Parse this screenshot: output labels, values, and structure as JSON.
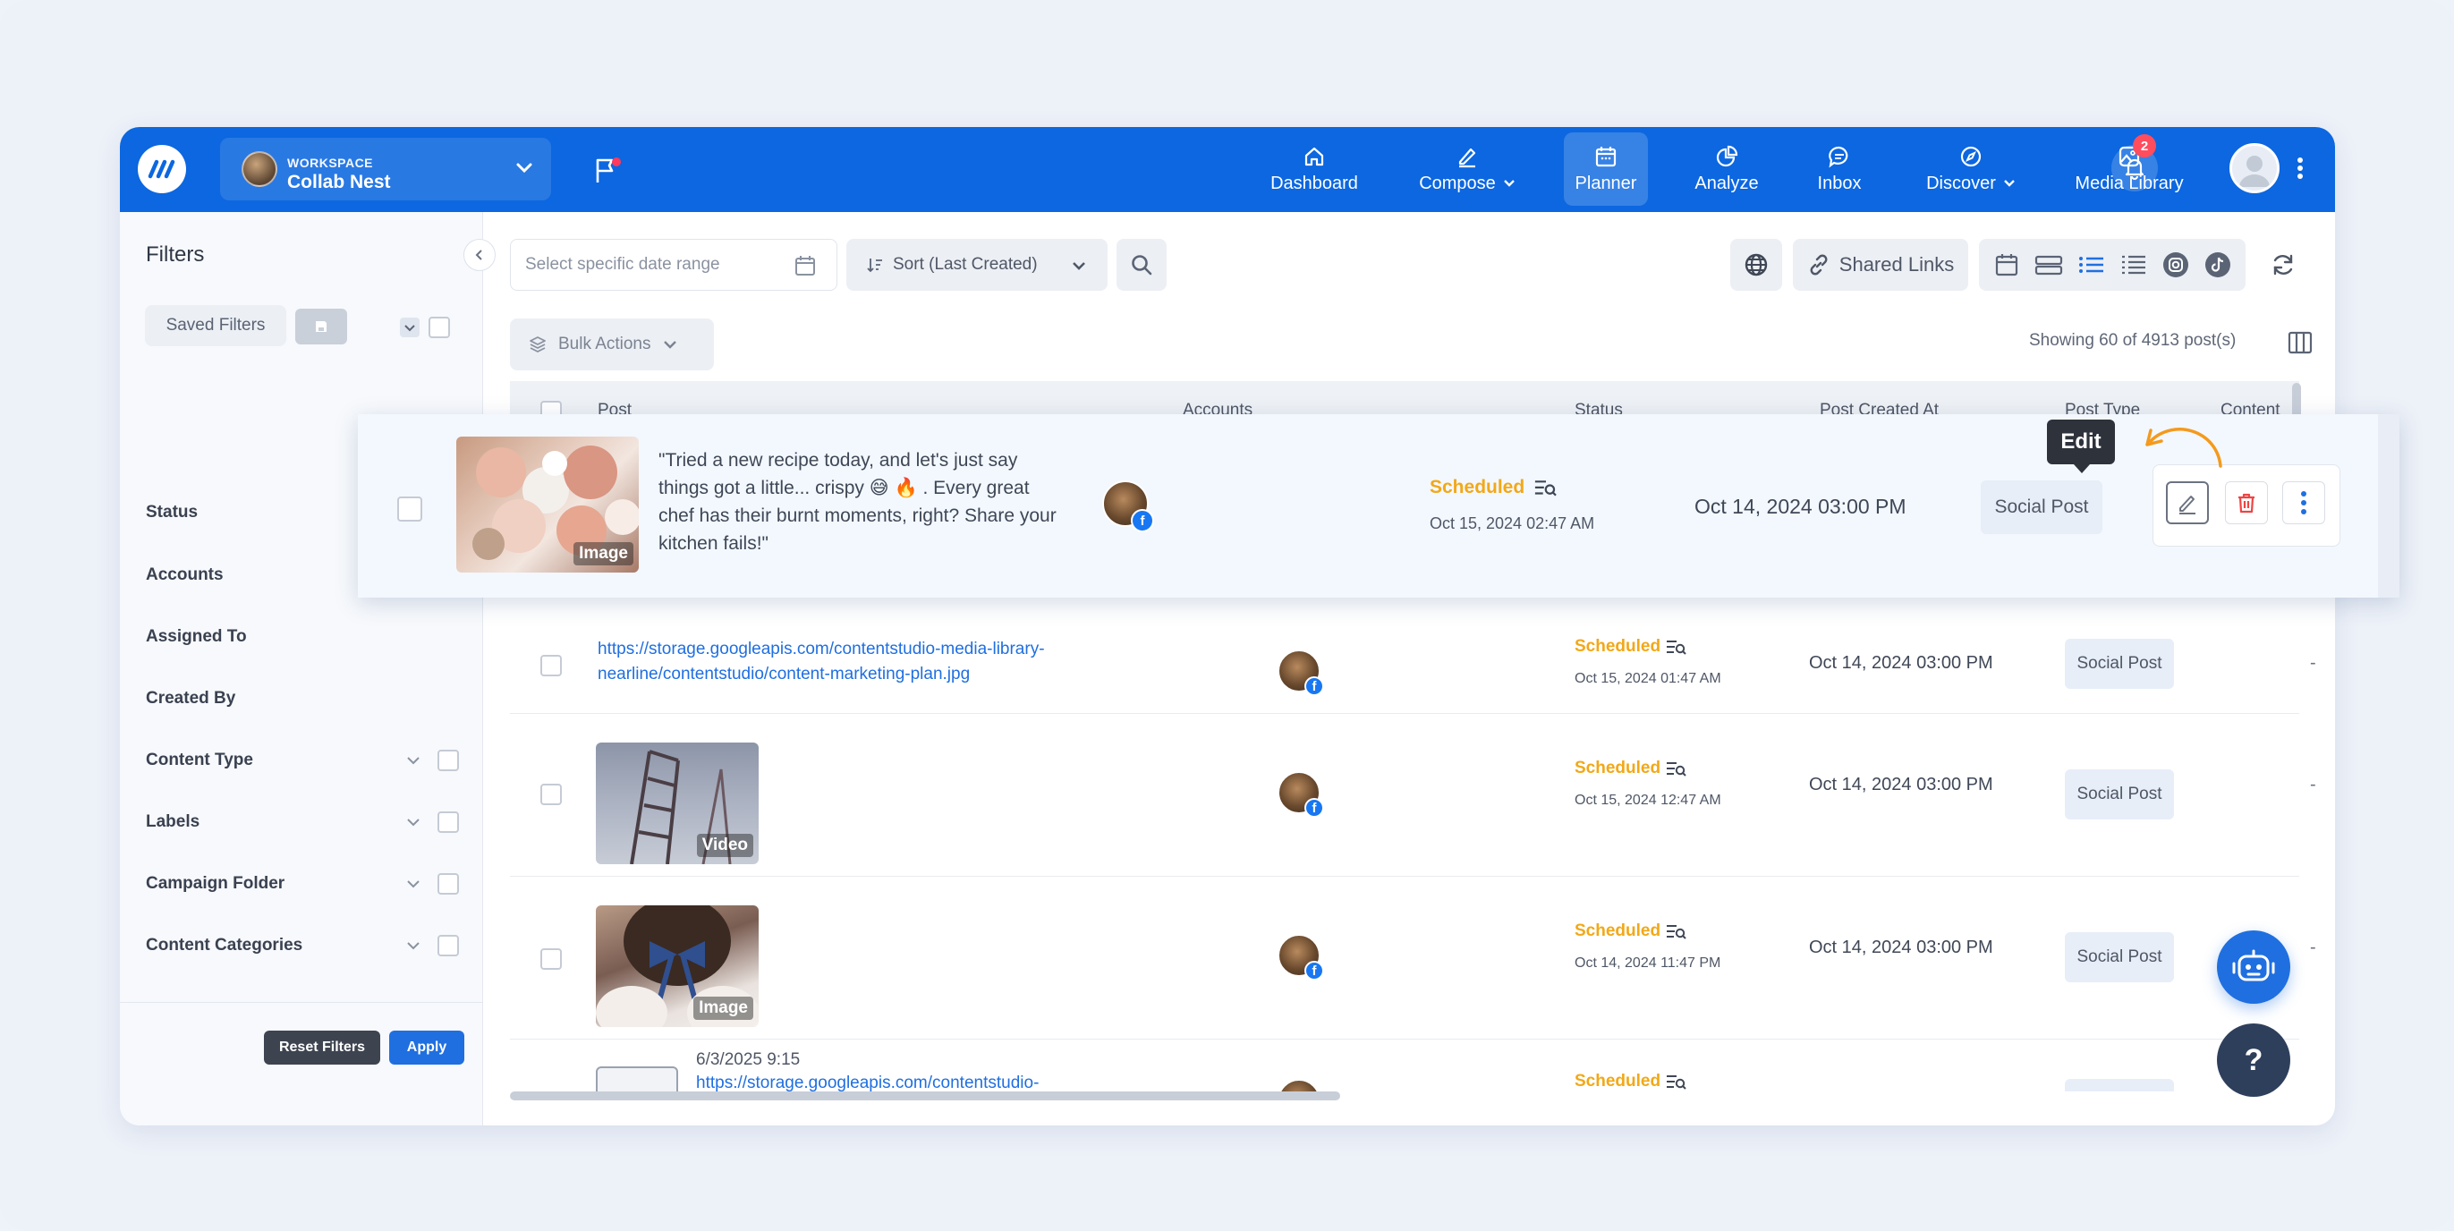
{
  "workspace": {
    "kicker": "WORKSPACE",
    "name": "Collab Nest"
  },
  "nav": {
    "items": [
      {
        "label": "Dashboard",
        "icon": "home-icon"
      },
      {
        "label": "Compose",
        "icon": "pen-icon"
      },
      {
        "label": "Planner",
        "icon": "calendar-icon",
        "active": true
      },
      {
        "label": "Analyze",
        "icon": "pie-chart-icon"
      },
      {
        "label": "Inbox",
        "icon": "chat-icon"
      },
      {
        "label": "Discover",
        "icon": "compass-icon"
      },
      {
        "label": "Media Library",
        "icon": "image-icon"
      }
    ],
    "notification_count": "2"
  },
  "filters": {
    "title": "Filters",
    "saved_filters_label": "Saved Filters",
    "rows": [
      "Status",
      "Accounts",
      "Assigned To",
      "Created By",
      "Content Type",
      "Labels",
      "Campaign Folder",
      "Content Categories"
    ],
    "reset_label": "Reset Filters",
    "apply_label": "Apply"
  },
  "toolbar": {
    "date_placeholder": "Select specific date range",
    "sort_label": "Sort (Last Created)",
    "shared_links_label": "Shared Links",
    "bulk_actions_label": "Bulk Actions",
    "showing_text": "Showing 60 of 4913 post(s)"
  },
  "table": {
    "headers": [
      "Post",
      "Accounts",
      "Status",
      "Post Created At",
      "Post Type",
      "Content Cate"
    ],
    "highlighted": {
      "caption": "\"Tried a new recipe today, and let's just say things got a little... crispy 😅 🔥 . Every great chef has their burnt moments, right? Share your kitchen fails!\"",
      "thumb_tag": "Image",
      "status": "Scheduled",
      "status_date": "Oct 15, 2024 02:47 AM",
      "created_at": "Oct 14, 2024 03:00 PM",
      "post_type": "Social Post",
      "tooltip": "Edit"
    },
    "rows": [
      {
        "link": "https://storage.googleapis.com/contentstudio-media-library-nearline/contentstudio/content-marketing-plan.jpg",
        "status": "Scheduled",
        "status_date": "Oct 15, 2024 01:47 AM",
        "created_at": "Oct 14, 2024 03:00 PM",
        "post_type": "Social Post",
        "category": "-"
      },
      {
        "thumb_tag": "Video",
        "status": "Scheduled",
        "status_date": "Oct 15, 2024 12:47 AM",
        "created_at": "Oct 14, 2024 03:00 PM",
        "post_type": "Social Post",
        "category": "-"
      },
      {
        "thumb_tag": "Image",
        "status": "Scheduled",
        "status_date": "Oct 14, 2024 11:47 PM",
        "created_at": "Oct 14, 2024 03:00 PM",
        "post_type": "Social Post",
        "category": "-"
      },
      {
        "date_line": "6/3/2025 9:15",
        "link": "https://storage.googleapis.com/contentstudio-",
        "status": "Scheduled"
      }
    ]
  },
  "help_label": "?",
  "colors": {
    "brand": "#0c67e0",
    "scheduled": "#f2a818",
    "facebook": "#1877f2"
  }
}
